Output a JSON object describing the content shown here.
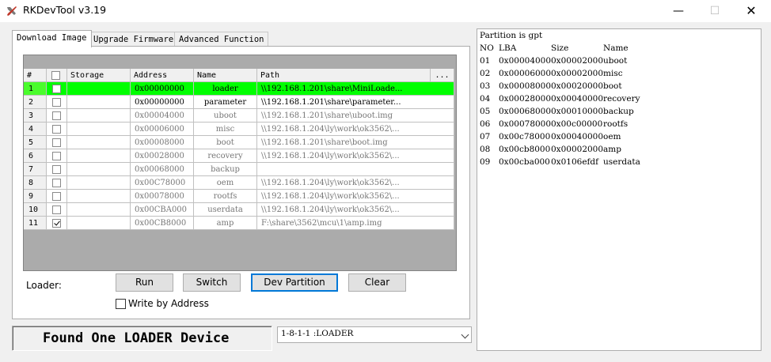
{
  "window": {
    "title": "RKDevTool v3.19",
    "min_glyph": "—",
    "max_glyph": "☐",
    "close_glyph": "✕"
  },
  "tabs": [
    {
      "label": "Download Image",
      "active": true
    },
    {
      "label": "Upgrade Firmware",
      "active": false
    },
    {
      "label": "Advanced Function",
      "active": false
    }
  ],
  "grid": {
    "headers": {
      "num": "#",
      "storage": "Storage",
      "address": "Address",
      "name": "Name",
      "path": "Path",
      "more": "..."
    },
    "rows": [
      {
        "num": "1",
        "checked": false,
        "storage": "",
        "address": "0x00000000",
        "name": "loader",
        "path": "\\\\192.168.1.201\\share\\MiniLoade...",
        "selected": true,
        "bold": true
      },
      {
        "num": "2",
        "checked": false,
        "storage": "",
        "address": "0x00000000",
        "name": "parameter",
        "path": "\\\\192.168.1.201\\share\\parameter...",
        "selected": false,
        "bold": true
      },
      {
        "num": "3",
        "checked": false,
        "storage": "",
        "address": "0x00004000",
        "name": "uboot",
        "path": "\\\\192.168.1.201\\share\\uboot.img",
        "selected": false,
        "bold": false
      },
      {
        "num": "4",
        "checked": false,
        "storage": "",
        "address": "0x00006000",
        "name": "misc",
        "path": "\\\\192.168.1.204\\ly\\work\\ok3562\\...",
        "selected": false,
        "bold": false
      },
      {
        "num": "5",
        "checked": false,
        "storage": "",
        "address": "0x00008000",
        "name": "boot",
        "path": "\\\\192.168.1.201\\share\\boot.img",
        "selected": false,
        "bold": false
      },
      {
        "num": "6",
        "checked": false,
        "storage": "",
        "address": "0x00028000",
        "name": "recovery",
        "path": "\\\\192.168.1.204\\ly\\work\\ok3562\\...",
        "selected": false,
        "bold": false
      },
      {
        "num": "7",
        "checked": false,
        "storage": "",
        "address": "0x00068000",
        "name": "backup",
        "path": "",
        "selected": false,
        "bold": false
      },
      {
        "num": "8",
        "checked": false,
        "storage": "",
        "address": "0x00C78000",
        "name": "oem",
        "path": "\\\\192.168.1.204\\ly\\work\\ok3562\\...",
        "selected": false,
        "bold": false
      },
      {
        "num": "9",
        "checked": false,
        "storage": "",
        "address": "0x00078000",
        "name": "rootfs",
        "path": "\\\\192.168.1.204\\ly\\work\\ok3562\\...",
        "selected": false,
        "bold": false
      },
      {
        "num": "10",
        "checked": false,
        "storage": "",
        "address": "0x00CBA000",
        "name": "userdata",
        "path": "\\\\192.168.1.204\\ly\\work\\ok3562\\...",
        "selected": false,
        "bold": false
      },
      {
        "num": "11",
        "checked": true,
        "storage": "",
        "address": "0x00CB8000",
        "name": "amp",
        "path": "F:\\share\\3562\\mcu\\1\\amp.img",
        "selected": false,
        "bold": false
      }
    ]
  },
  "controls": {
    "loader_label": "Loader:",
    "run": "Run",
    "switch": "Switch",
    "dev_partition": "Dev Partition",
    "clear": "Clear",
    "write_by_address": "Write by Address",
    "write_by_address_checked": false
  },
  "status": {
    "text": "Found One LOADER Device",
    "device": "1-8-1-1  :LOADER"
  },
  "log": {
    "header": "Partition is gpt",
    "columns": {
      "no": "NO",
      "lba": "LBA",
      "size": "Size",
      "name": "Name"
    },
    "rows": [
      {
        "no": "01",
        "lba": "0x00004000",
        "size": "0x00002000",
        "name": "uboot"
      },
      {
        "no": "02",
        "lba": "0x00006000",
        "size": "0x00002000",
        "name": "misc"
      },
      {
        "no": "03",
        "lba": "0x00008000",
        "size": "0x00020000",
        "name": "boot"
      },
      {
        "no": "04",
        "lba": "0x00028000",
        "size": "0x00040000",
        "name": "recovery"
      },
      {
        "no": "05",
        "lba": "0x00068000",
        "size": "0x00010000",
        "name": "backup"
      },
      {
        "no": "06",
        "lba": "0x00078000",
        "size": "0x00c00000",
        "name": "rootfs"
      },
      {
        "no": "07",
        "lba": "0x00c78000",
        "size": "0x00040000",
        "name": "oem"
      },
      {
        "no": "08",
        "lba": "0x00cb8000",
        "size": "0x00002000",
        "name": "amp"
      },
      {
        "no": "09",
        "lba": "0x00cba000",
        "size": "0x0106efdf",
        "name": "userdata"
      }
    ]
  }
}
